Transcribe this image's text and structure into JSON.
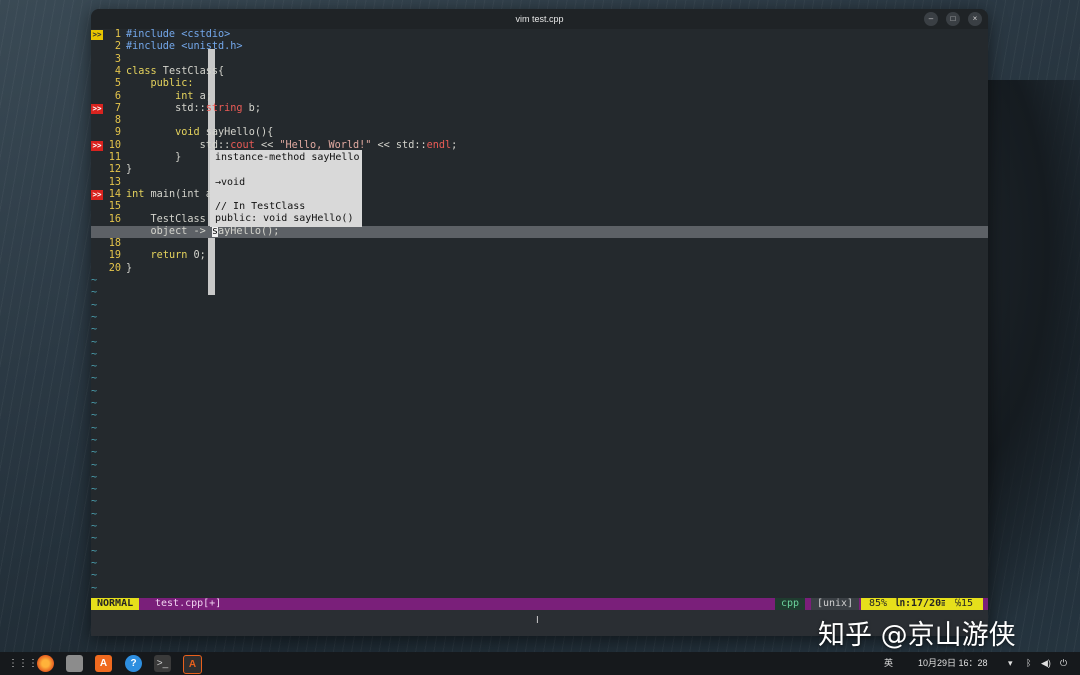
{
  "window": {
    "title": "vim test.cpp",
    "minimize": "–",
    "maximize": "□",
    "close": "×"
  },
  "editor": {
    "lines": [
      {
        "n": "1",
        "sign": ">>",
        "sign_type": "warn"
      },
      {
        "n": "2"
      },
      {
        "n": "3"
      },
      {
        "n": "4"
      },
      {
        "n": "5"
      },
      {
        "n": "6"
      },
      {
        "n": "7",
        "sign": ">>",
        "sign_type": "err"
      },
      {
        "n": "8"
      },
      {
        "n": "9"
      },
      {
        "n": "10",
        "sign": ">>",
        "sign_type": "err"
      },
      {
        "n": "11"
      },
      {
        "n": "12"
      },
      {
        "n": "13"
      },
      {
        "n": "14",
        "sign": ">>",
        "sign_type": "err"
      },
      {
        "n": "15"
      },
      {
        "n": "16"
      },
      {
        "n": "17"
      },
      {
        "n": "18"
      },
      {
        "n": "19"
      },
      {
        "n": "20"
      }
    ],
    "code": {
      "l1a": "#include ",
      "l1b": "<cstdio>",
      "l2a": "#include ",
      "l2b": "<unistd.h>",
      "l4a": "class",
      "l4b": " TestClass{",
      "l5": "    public:",
      "l6a": "        ",
      "l6b": "int",
      "l6c": " a;",
      "l7a": "        std::",
      "l7b": "string",
      "l7c": " b;",
      "l9a": "        ",
      "l9b": "void",
      "l9c": " sayHello(){",
      "l10a": "            std::",
      "l10b": "cout",
      "l10c": " << ",
      "l10d": "\"Hello, World!\"",
      "l10e": " << std::",
      "l10f": "endl",
      "l10g": ";",
      "l11": "        }",
      "l12": "}",
      "l14a": "int",
      "l14b": " main(int a",
      "l16": "    TestClass ",
      "l17a": "    object -> ",
      "l17b": "s",
      "l17c": "ayHello();",
      "l19a": "    ",
      "l19b": "return",
      "l19c": " 0;",
      "l20": "}"
    },
    "tilde": "~"
  },
  "popup": {
    "line1": "instance-method sayHello",
    "line2": "",
    "line3": "→void",
    "line4": "",
    "line5": "// In TestClass",
    "line6": "public: void sayHello()"
  },
  "statusline": {
    "mode": "NORMAL",
    "file": "test.cpp[+]",
    "filetype": "cpp",
    "fileformat": "[unix]",
    "percent": "85%",
    "position": "㏑:17/20≡",
    "column": "℅15"
  },
  "watermark": "知乎 @京山游侠",
  "taskbar": {
    "apps": [
      "app-grid",
      "firefox",
      "files",
      "app-store",
      "help",
      "terminal",
      "alacritty"
    ],
    "ime": "英",
    "datetime": "10月29日 16：28"
  },
  "colors": {
    "accent_yellow": "#e6df1b",
    "status_purple": "#7a1f7a",
    "error_red": "#d9231f"
  }
}
